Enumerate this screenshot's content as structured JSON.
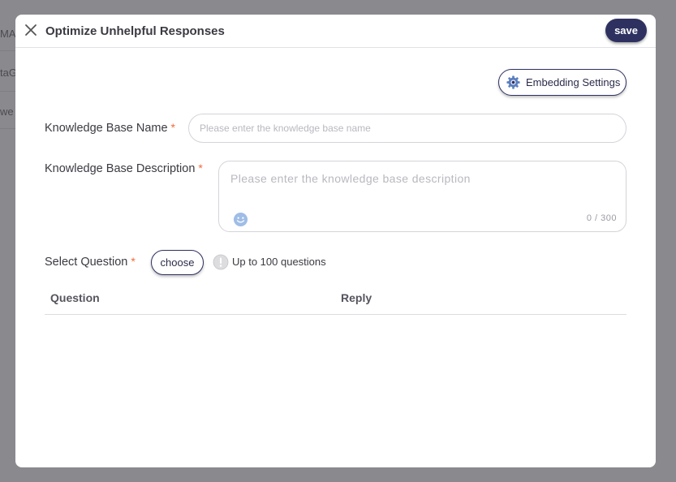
{
  "background": {
    "fragments": [
      "MA",
      "taG",
      "we"
    ]
  },
  "dialog": {
    "title": "Optimize Unhelpful Responses",
    "close_icon": "close-icon",
    "save_label": "save",
    "embedding_settings_label": "Embedding Settings",
    "embedding_icon": "gear-icon"
  },
  "form": {
    "kb_name": {
      "label": "Knowledge Base Name",
      "required_mark": "*",
      "placeholder": "Please enter the knowledge base name",
      "value": ""
    },
    "kb_description": {
      "label": "Knowledge Base Description",
      "required_mark": "*",
      "placeholder": "Please enter the knowledge base description",
      "value": "",
      "counter": "0 / 300",
      "emoji_icon": "smiley-icon"
    },
    "select_question": {
      "label": "Select Question",
      "required_mark": "*",
      "choose_label": "choose",
      "hint_icon": "info-icon",
      "hint": "Up to 100 questions"
    }
  },
  "table": {
    "columns": [
      "Question",
      "Reply"
    ],
    "rows": []
  },
  "colors": {
    "accent": "#2e3160",
    "required": "#f26a3a",
    "overlay": "#8a8a8e"
  }
}
